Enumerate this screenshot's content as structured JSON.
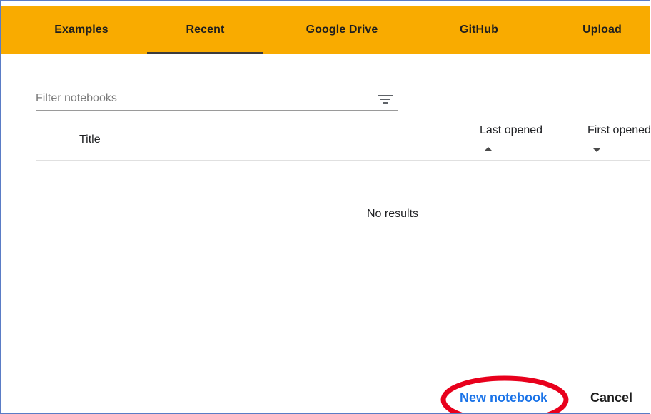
{
  "tabs": [
    {
      "label": "Examples"
    },
    {
      "label": "Recent"
    },
    {
      "label": "Google Drive"
    },
    {
      "label": "GitHub"
    },
    {
      "label": "Upload"
    }
  ],
  "active_tab": "Recent",
  "filter": {
    "placeholder": "Filter notebooks",
    "value": ""
  },
  "columns": {
    "title": "Title",
    "last_opened": "Last opened",
    "first_opened": "First opened",
    "last_opened_sort": "ascending",
    "first_opened_sort": "descending"
  },
  "empty_state": "No results",
  "actions": {
    "new_notebook": "New notebook",
    "cancel": "Cancel"
  },
  "colors": {
    "tab_bar": "#f9ab00",
    "primary_action": "#1a73e8",
    "highlight_annotation": "#e8001c",
    "frame_border": "#5a7cc6"
  },
  "icons": {
    "filter": "filter-list-icon",
    "sort_up": "arrow-up-icon",
    "sort_down": "arrow-down-icon"
  }
}
